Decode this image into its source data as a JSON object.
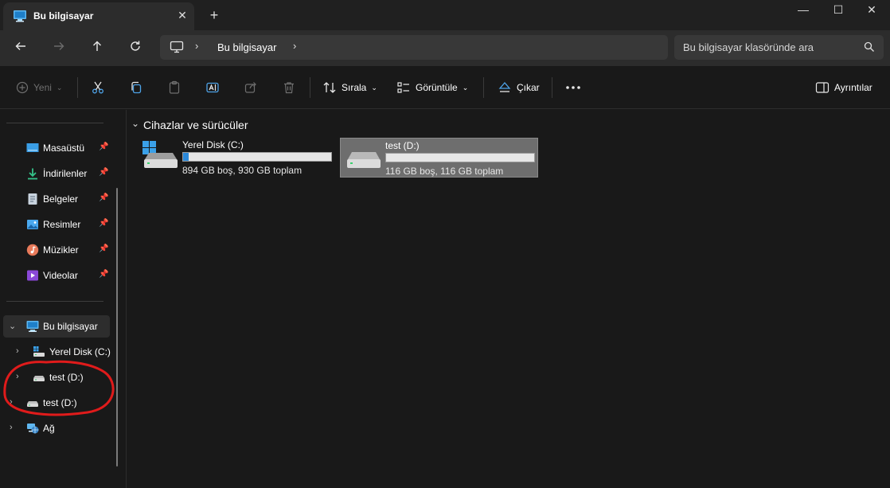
{
  "tab": {
    "title": "Bu bilgisayar"
  },
  "window": {
    "minimize": "—",
    "maximize": "☐",
    "close": "✕"
  },
  "address": {
    "crumb": "Bu bilgisayar"
  },
  "search": {
    "placeholder": "Bu bilgisayar klasöründe ara"
  },
  "commands": {
    "new_label": "Yeni",
    "sort_label": "Sırala",
    "view_label": "Görüntüle",
    "eject_label": "Çıkar",
    "details_label": "Ayrıntılar"
  },
  "sidebar": {
    "quick_access": [
      {
        "label": "Masaüstü",
        "icon": "desktop-icon"
      },
      {
        "label": "İndirilenler",
        "icon": "downloads-icon"
      },
      {
        "label": "Belgeler",
        "icon": "documents-icon"
      },
      {
        "label": "Resimler",
        "icon": "pictures-icon"
      },
      {
        "label": "Müzikler",
        "icon": "music-icon"
      },
      {
        "label": "Videolar",
        "icon": "videos-icon"
      }
    ],
    "tree": [
      {
        "label": "Bu bilgisayar",
        "icon": "computer-icon",
        "expanded": true,
        "selected": true
      },
      {
        "label": "Yerel Disk (C:)",
        "icon": "windows-drive-icon"
      },
      {
        "label": "test (D:)",
        "icon": "drive-icon"
      },
      {
        "label": "test (D:)",
        "icon": "drive-icon"
      },
      {
        "label": "Ağ",
        "icon": "network-icon"
      }
    ]
  },
  "content": {
    "group_title": "Cihazlar ve sürücüler",
    "drives": [
      {
        "name": "Yerel Disk (C:)",
        "free_text": "894 GB boş, 930 GB toplam",
        "used_fraction": 0.039,
        "selected": false
      },
      {
        "name": "test (D:)",
        "free_text": "116 GB boş, 116 GB toplam",
        "used_fraction": 0.0,
        "selected": true
      }
    ]
  },
  "colors": {
    "accent": "#2b88d8",
    "annotation": "#e01b1b",
    "background": "#191919"
  }
}
